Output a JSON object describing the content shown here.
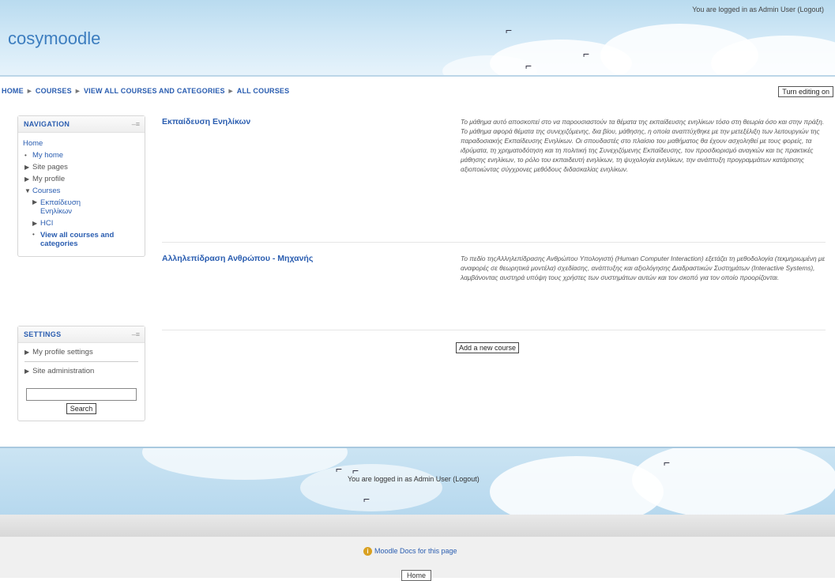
{
  "header": {
    "site_name": "cosymoodle",
    "login_text": "You are logged in as Admin User (Logout)"
  },
  "navbar": {
    "breadcrumb": [
      "HOME",
      "COURSES",
      "VIEW ALL COURSES AND CATEGORIES",
      "ALL COURSES"
    ],
    "separator": "►",
    "edit_button": "Turn editing on"
  },
  "navigation": {
    "title": "NAVIGATION",
    "home": "Home",
    "my_home": "My home",
    "site_pages": "Site pages",
    "my_profile": "My profile",
    "courses": "Courses",
    "course_1": "Εκπαίδευση Ενηλίκων",
    "course_2": "HCI",
    "view_all": "View all courses and categories"
  },
  "settings": {
    "title": "SETTINGS",
    "profile_settings": "My profile settings",
    "site_admin": "Site administration",
    "search_value": "",
    "search_button": "Search"
  },
  "courses": [
    {
      "name": "Εκπαίδευση Ενηλίκων",
      "summary": "Το μάθημα αυτό αποσκοπεί στο να παρουσιαστούν τα θέματα της εκπαίδευσης ενηλίκων τόσο στη θεωρία όσο και στην πράξη. Το μάθημα αφορά θέματα της συνεχιζόμενης, δια βίου, μάθησης, η οποία αναπτύχθηκε με την μετεξέλιξη των λειτουργιών της παραδοσιακής Εκπαίδευσης Ενηλίκων. Οι σπουδαστές στο πλαίσιο του μαθήματος θα έχουν ασχοληθεί με τους φορείς, τα ιδρύματα, τη χρηματοδότηση και τη πολιτική της Συνεχιζόμενης Εκπαίδευσης, τον προσδιορισμό αναγκών και τις πρακτικές μάθησης ενηλίκων, το ρόλο του εκπαιδευτή ενηλίκων, τη ψυχολογία ενηλίκων, την ανάπτυξη προγραμμάτων κατάρτισης αξιοποιώντας σύγχρονες μεθόδους διδασκαλίας ενηλίκων."
    },
    {
      "name": "Αλληλεπίδραση Ανθρώπου - Μηχανής",
      "summary": "Το πεδίο τηςΑλληλεπίδρασης Ανθρώπου Υπολογιστή (Human Computer Interaction) εξετάζει τη μεθοδολογία (τεκμηριωμένη με αναφορές σε θεωρητικά μοντέλα) σχεδίασης, ανάπτυξης και αξιολόγησης Διαδραστικών Συστημάτων (Interactive Systems), λαμβάνοντας αυστηρά υπόψη τους χρήστες των συστημάτων αυτών και τον σκοπό για τον οποίο προορίζονται."
    }
  ],
  "add_course_button": "Add a new course",
  "footer": {
    "login_text": "You are logged in as Admin User (Logout)",
    "docs_link": "Moodle Docs for this page",
    "home_button": "Home"
  },
  "colors": {
    "link": "#2a5db0",
    "header_sky": "#b9dbef",
    "logo": "#3c7dbf"
  }
}
